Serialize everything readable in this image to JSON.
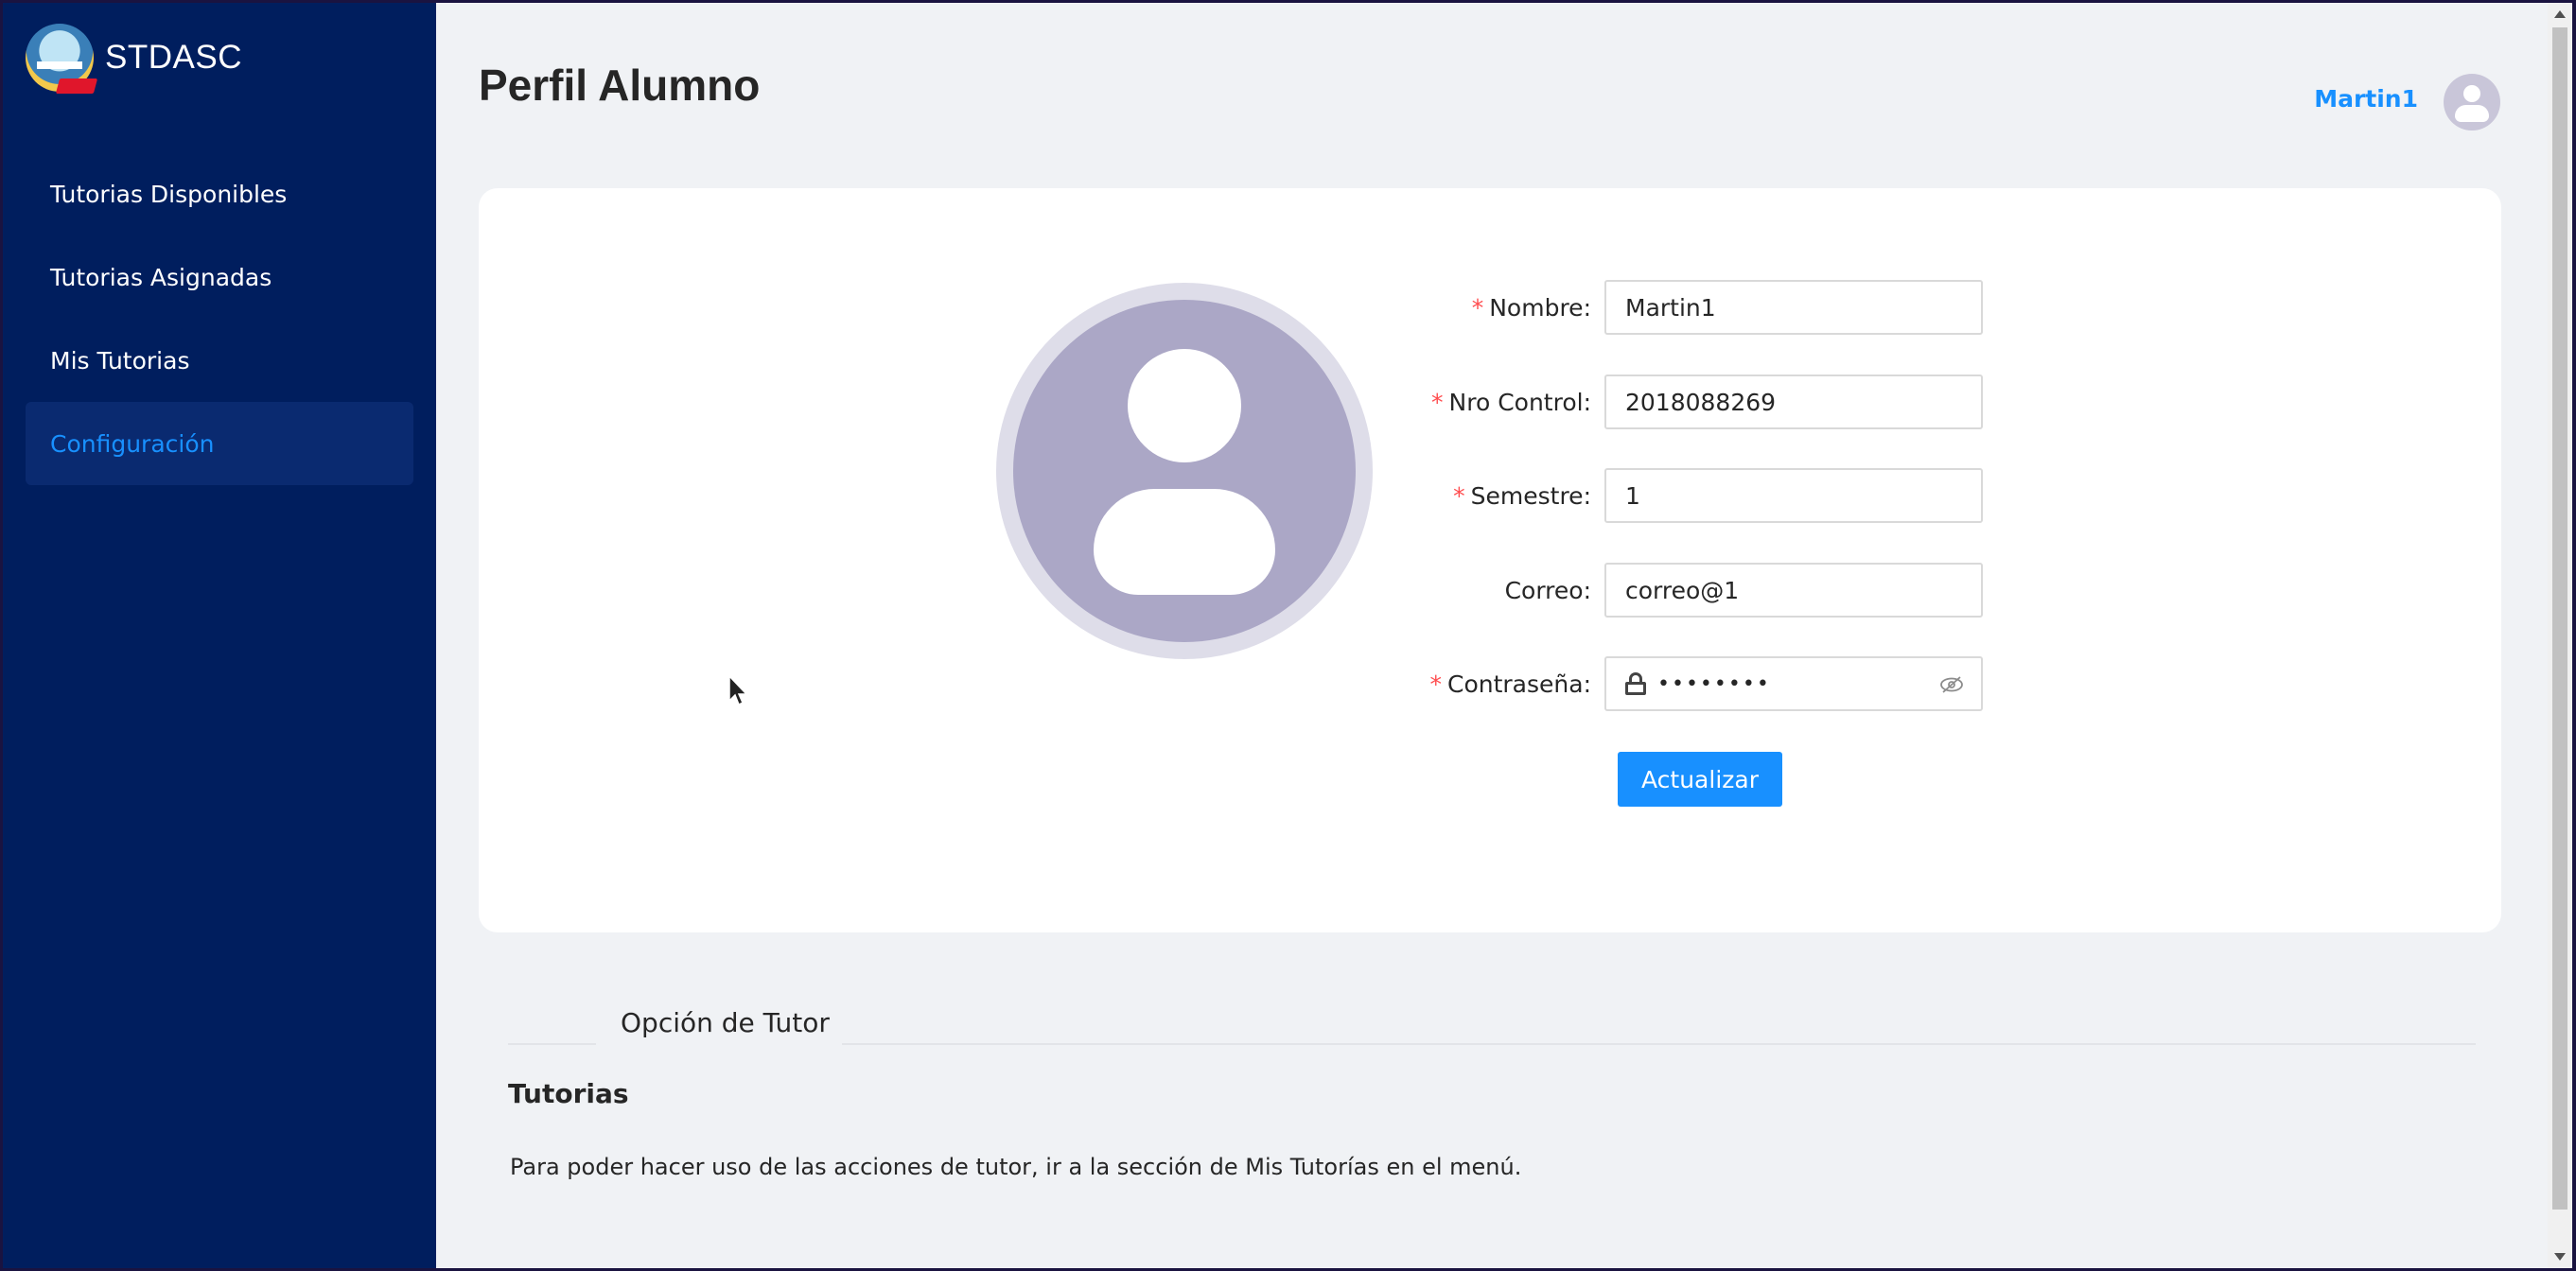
{
  "brand": {
    "name": "STDASC"
  },
  "sidebar": {
    "items": [
      {
        "label": "Tutorias Disponibles",
        "active": false
      },
      {
        "label": "Tutorias Asignadas",
        "active": false
      },
      {
        "label": "Mis Tutorias",
        "active": false
      },
      {
        "label": "Configuración",
        "active": true
      }
    ]
  },
  "header": {
    "title": "Perfil Alumno",
    "username": "Martin1"
  },
  "form": {
    "nombre": {
      "label": "Nombre",
      "value": "Martin1",
      "required": true
    },
    "nro_control": {
      "label": "Nro Control",
      "value": "2018088269",
      "required": true
    },
    "semestre": {
      "label": "Semestre",
      "value": "1",
      "required": true
    },
    "correo": {
      "label": "Correo",
      "value": "correo@1",
      "required": false
    },
    "contrasena": {
      "label": "Contraseña",
      "masked_value": "••••••••",
      "required": true
    },
    "submit_label": "Actualizar",
    "label_suffix": ":",
    "required_mark": "*"
  },
  "tutor_section": {
    "divider_text": "Opción de Tutor",
    "title": "Tutorias",
    "description": "Para poder hacer uso de las acciones de tutor, ir a la sección de Mis Tutorías en el menú."
  },
  "colors": {
    "sidebar_bg": "#001e5e",
    "accent": "#1890ff",
    "required": "#ff4d4f",
    "page_bg": "#f0f2f5"
  },
  "icons": [
    "logo",
    "user-avatar-icon",
    "lock-icon",
    "eye-invisible-icon",
    "mouse-cursor-icon"
  ]
}
